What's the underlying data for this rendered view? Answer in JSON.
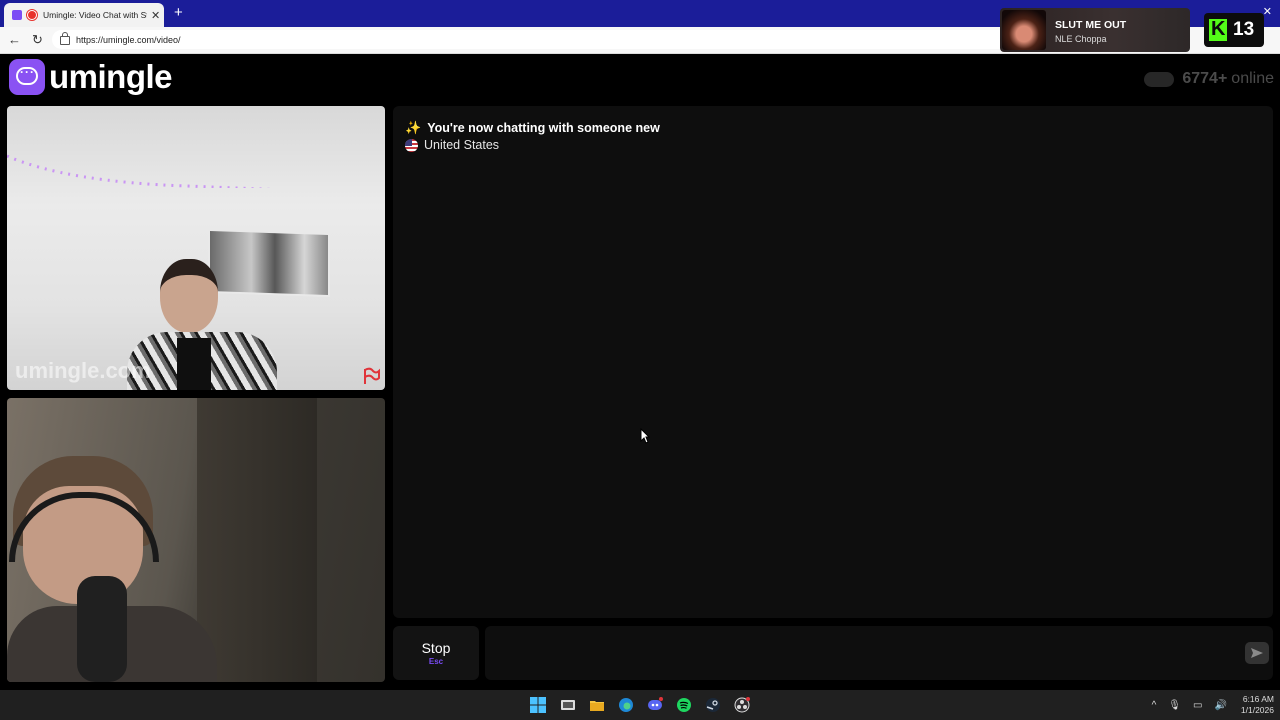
{
  "browser": {
    "tab_title": "Umingle: Video Chat with Strangers",
    "new_tab_icon": "plus-icon",
    "url": "https://umingle.com/video/",
    "back_icon": "arrow-left-icon",
    "reload_icon": "reload-icon"
  },
  "now_playing": {
    "title": "SLUT ME OUT",
    "artist": "NLE Choppa"
  },
  "kick": {
    "count": "13"
  },
  "app": {
    "logo": "umingle",
    "online_count": "6774+",
    "online_label": "online",
    "brand_color": "#8a52f3"
  },
  "video": {
    "watermark": "umingle.com"
  },
  "chat": {
    "system_message": "You're now chatting with someone new",
    "country": "United States",
    "stop_label": "Stop",
    "stop_shortcut": "Esc",
    "message_placeholder": "",
    "send_icon": "send-icon"
  },
  "taskbar": {
    "time": "6:16 AM",
    "date": "1/1/2026",
    "icons": [
      "windows-start-icon",
      "task-view-icon",
      "file-explorer-icon",
      "edge-icon",
      "discord-icon",
      "spotify-icon",
      "steam-icon",
      "obs-icon"
    ]
  }
}
